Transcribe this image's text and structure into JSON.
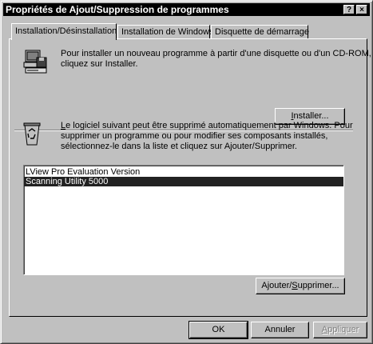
{
  "window": {
    "title": "Propriétés de Ajout/Suppression de programmes",
    "help_button": "?",
    "close_button": "×"
  },
  "tabs": [
    {
      "label": "Installation/Désinstallation",
      "active": true
    },
    {
      "label": "Installation de Windows",
      "active": false
    },
    {
      "label": "Disquette de démarrage",
      "active": false
    }
  ],
  "install_section": {
    "icon": "floppy-computer-icon",
    "line1": "Pour installer un nouveau programme à partir d'une disquette ou d'un CD-ROM,",
    "line2": "cliquez sur Installer.",
    "button_prefix": "",
    "button_mnemonic": "I",
    "button_rest": "nstaller..."
  },
  "uninstall_section": {
    "icon": "recycle-bin-icon",
    "line1": "Le logiciel suivant peut être supprimé automatiquement par Windows. Pour",
    "line2": "supprimer un programme ou pour modifier ses composants installés,",
    "line3": "sélectionnez-le dans la liste et cliquez sur Ajouter/Supprimer.",
    "line1_mnemonic": "L",
    "line1_rest": "e logiciel suivant peut être supprimé automatiquement par Windows. Pour",
    "programs": [
      {
        "name": "LView Pro Evaluation Version",
        "selected": false
      },
      {
        "name": "Scanning Utility 5000",
        "selected": true
      }
    ],
    "button_prefix": "Ajouter/",
    "button_mnemonic": "S",
    "button_rest": "upprimer..."
  },
  "footer": {
    "ok": "OK",
    "cancel": "Annuler",
    "apply_mnemonic": "A",
    "apply_rest": "ppliquer",
    "apply_enabled": false
  }
}
